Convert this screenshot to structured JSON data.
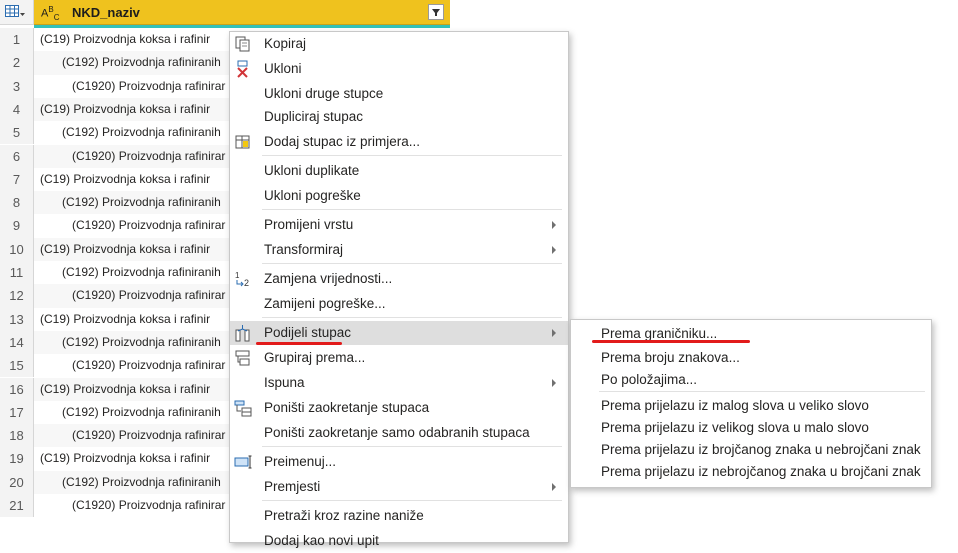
{
  "table": {
    "type_label": "A",
    "type_sup": "B",
    "type_sub": "C",
    "column_name": "NKD_naziv",
    "rows": [
      {
        "num": "1",
        "value": "(C19) Proizvodnja koksa i rafinir"
      },
      {
        "num": "2",
        "value": "(C192) Proizvodnja rafiniranih"
      },
      {
        "num": "3",
        "value": "(C1920) Proizvodnja rafinirar"
      },
      {
        "num": "4",
        "value": "(C19) Proizvodnja koksa i rafinir"
      },
      {
        "num": "5",
        "value": "(C192) Proizvodnja rafiniranih"
      },
      {
        "num": "6",
        "value": "(C1920) Proizvodnja rafinirar"
      },
      {
        "num": "7",
        "value": "(C19) Proizvodnja koksa i rafinir"
      },
      {
        "num": "8",
        "value": "(C192) Proizvodnja rafiniranih"
      },
      {
        "num": "9",
        "value": "(C1920) Proizvodnja rafinirar"
      },
      {
        "num": "10",
        "value": "(C19) Proizvodnja koksa i rafinir"
      },
      {
        "num": "11",
        "value": "(C192) Proizvodnja rafiniranih"
      },
      {
        "num": "12",
        "value": "(C1920) Proizvodnja rafinirar"
      },
      {
        "num": "13",
        "value": "(C19) Proizvodnja koksa i rafinir"
      },
      {
        "num": "14",
        "value": "(C192) Proizvodnja rafiniranih"
      },
      {
        "num": "15",
        "value": "(C1920) Proizvodnja rafinirar"
      },
      {
        "num": "16",
        "value": "(C19) Proizvodnja koksa i rafinir"
      },
      {
        "num": "17",
        "value": "(C192) Proizvodnja rafiniranih"
      },
      {
        "num": "18",
        "value": "(C1920) Proizvodnja rafinirar"
      },
      {
        "num": "19",
        "value": "(C19) Proizvodnja koksa i rafinir"
      },
      {
        "num": "20",
        "value": "(C192) Proizvodnja rafiniranih"
      },
      {
        "num": "21",
        "value": "(C1920) Proizvodnja rafinirar"
      }
    ]
  },
  "context_menu": {
    "items": [
      {
        "label": "Kopiraj",
        "icon": "copy-icon"
      },
      {
        "label": "Ukloni",
        "icon": "remove-icon"
      },
      {
        "label": "Ukloni druge stupce"
      },
      {
        "label": "Dupliciraj stupac"
      },
      {
        "label": "Dodaj stupac iz primjera...",
        "icon": "column-from-examples-icon"
      },
      {
        "label": "Ukloni duplikate"
      },
      {
        "label": "Ukloni pogreške"
      },
      {
        "label": "Promijeni vrstu",
        "submenu": true
      },
      {
        "label": "Transformiraj",
        "submenu": true
      },
      {
        "label": "Zamjena vrijednosti...",
        "icon": "replace-values-icon"
      },
      {
        "label": "Zamijeni pogreške..."
      },
      {
        "label": "Podijeli stupac",
        "icon": "split-column-icon",
        "submenu": true,
        "highlighted": true
      },
      {
        "label": "Grupiraj prema...",
        "icon": "group-by-icon"
      },
      {
        "label": "Ispuna",
        "submenu": true
      },
      {
        "label": "Poništi zaokretanje stupaca",
        "icon": "unpivot-icon"
      },
      {
        "label": "Poništi zaokretanje samo odabranih stupaca"
      },
      {
        "label": "Preimenuj...",
        "icon": "rename-icon"
      },
      {
        "label": "Premjesti",
        "submenu": true
      },
      {
        "label": "Pretraži kroz razine naniže"
      },
      {
        "label": "Dodaj kao novi upit"
      }
    ]
  },
  "split_submenu": {
    "items": [
      "Prema graničniku...",
      "Prema broju znakova...",
      "Po položajima...",
      "Prema prijelazu iz malog slova u veliko slovo",
      "Prema prijelazu iz velikog slova u malo slovo",
      "Prema prijelazu iz brojčanog znaka u nebrojčani znak",
      "Prema prijelazu iz nebrojčanog znaka u brojčani znak"
    ]
  },
  "colors": {
    "column_header": "#efc21e",
    "quality_bar": "#33c1b8",
    "highlight": "#dedede",
    "annotation": "#e21b1b"
  }
}
